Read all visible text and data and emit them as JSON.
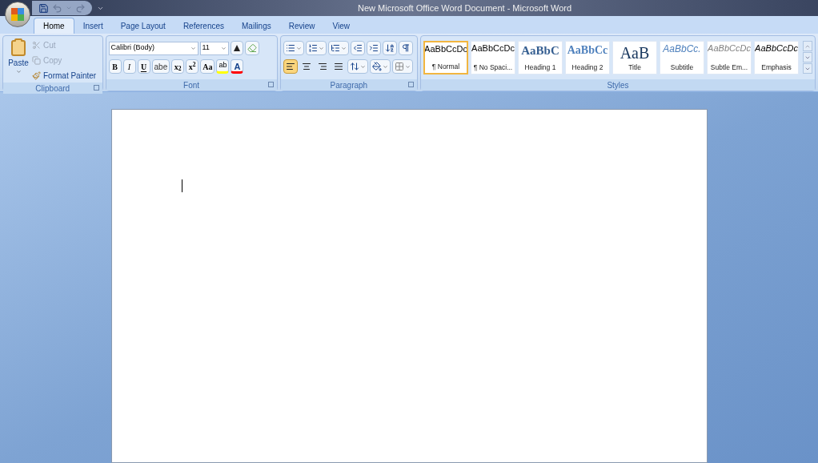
{
  "window": {
    "title": "New Microsoft Office Word Document - Microsoft Word"
  },
  "tabs": [
    {
      "label": "Home",
      "selected": true
    },
    {
      "label": "Insert",
      "selected": false
    },
    {
      "label": "Page Layout",
      "selected": false
    },
    {
      "label": "References",
      "selected": false
    },
    {
      "label": "Mailings",
      "selected": false
    },
    {
      "label": "Review",
      "selected": false
    },
    {
      "label": "View",
      "selected": false
    }
  ],
  "clipboard": {
    "label": "Clipboard",
    "paste": "Paste",
    "items": [
      {
        "kind": "cut",
        "label": "Cut",
        "disabled": true
      },
      {
        "kind": "copy",
        "label": "Copy",
        "disabled": true
      },
      {
        "kind": "painter",
        "label": "Format Painter",
        "disabled": false
      }
    ]
  },
  "font": {
    "label": "Font",
    "family": "Calibri (Body)",
    "size": "11",
    "buttons": [
      {
        "kind": "bold",
        "label": "B"
      },
      {
        "kind": "italic",
        "label": "I"
      },
      {
        "kind": "underline",
        "label": "U"
      },
      {
        "kind": "strike",
        "label": "abe"
      },
      {
        "kind": "plain",
        "label": "x$_{2}$"
      },
      {
        "kind": "plain",
        "label": "x$^{2}$"
      },
      {
        "kind": "plain",
        "label": "Aa"
      }
    ],
    "highlight": "ab",
    "font_color": "A"
  },
  "paragraph": {
    "label": "Paragraph",
    "alignments": [
      {
        "kind": "left",
        "selected": true
      },
      {
        "kind": "center",
        "selected": false
      },
      {
        "kind": "right",
        "selected": false
      },
      {
        "kind": "justify",
        "selected": false
      }
    ]
  },
  "styles": {
    "label": "Styles",
    "items": [
      {
        "kind": "normal",
        "sample": "AaBbCcDc",
        "name": "¶ Normal",
        "selected": true
      },
      {
        "kind": "normal",
        "sample": "AaBbCcDc",
        "name": "¶ No Spaci...",
        "selected": false
      },
      {
        "kind": "heading1",
        "sample": "AaBbC",
        "name": "Heading 1",
        "selected": false
      },
      {
        "kind": "heading2",
        "sample": "AaBbCc",
        "name": "Heading 2",
        "selected": false
      },
      {
        "kind": "title",
        "sample": "AaB",
        "name": "Title",
        "selected": false
      },
      {
        "kind": "subtitle",
        "sample": "AaBbCc.",
        "name": "Subtitle",
        "selected": false
      },
      {
        "kind": "subtle",
        "sample": "AaBbCcDc",
        "name": "Subtle Em...",
        "selected": false
      },
      {
        "kind": "emphasis",
        "sample": "AaBbCcDc",
        "name": "Emphasis",
        "selected": false
      }
    ]
  }
}
